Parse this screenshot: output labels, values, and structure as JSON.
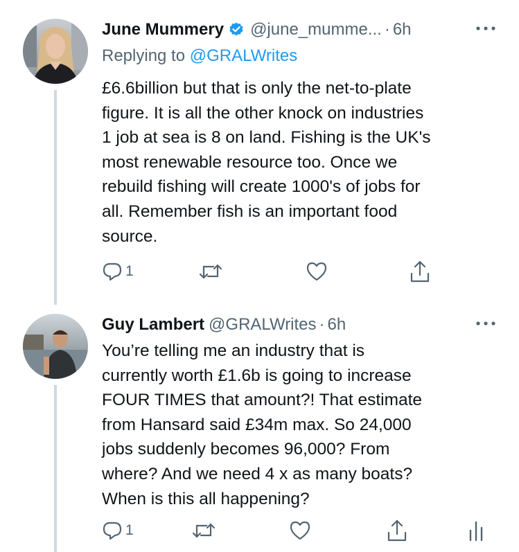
{
  "tweets": [
    {
      "author_name": "June Mummery",
      "verified": true,
      "handle": "@june_mumme...",
      "separator": "·",
      "time": "6h",
      "replying_prefix": "Replying to",
      "replying_to": "@GRALWrites",
      "lines": [
        "£6.6billion but that is only the net-to-plate",
        "figure. It is all the other knock on industries",
        "1 job at sea is 8 on land. Fishing is the UK's",
        "most renewable resource too. Once we",
        "rebuild fishing will create 1000's of jobs for",
        "all. Remember fish  is an important food",
        "source."
      ],
      "reply_count": "1",
      "icons": [
        "reply-icon",
        "retweet-icon",
        "like-icon",
        "share-icon"
      ]
    },
    {
      "author_name": "Guy Lambert",
      "verified": false,
      "handle": "@GRALWrites",
      "separator": "·",
      "time": "6h",
      "lines": [
        "You’re telling me an industry that is",
        "currently worth £1.6b is going to increase",
        "FOUR TIMES that amount?! That estimate",
        "from Hansard said £34m max. So 24,000",
        "jobs suddenly becomes 96,000? From",
        "where? And we need 4 x as many boats?",
        "When is this all happening?"
      ],
      "reply_count": "1",
      "icons": [
        "reply-icon",
        "retweet-icon",
        "like-icon",
        "share-icon",
        "analytics-icon"
      ]
    }
  ],
  "colors": {
    "text": "#0f1419",
    "secondary": "#536471",
    "accent": "#1d9bf0",
    "thread_line": "#cfd9de"
  }
}
